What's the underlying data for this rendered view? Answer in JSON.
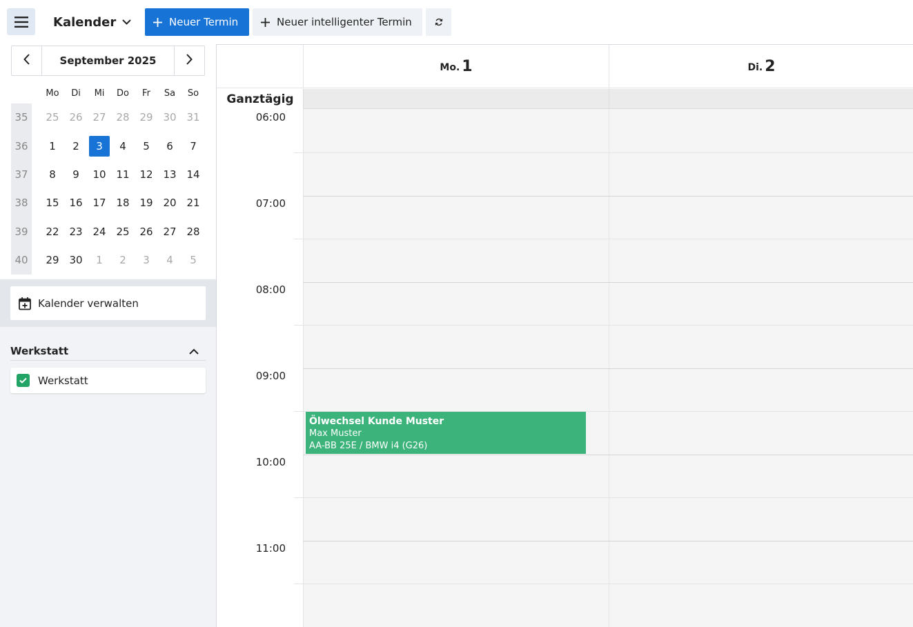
{
  "toolbar": {
    "calendar_title": "Kalender",
    "new_appointment": "Neuer Termin",
    "new_smart_appointment": "Neuer intelligenter Termin",
    "icons": {
      "menu": "hamburger-icon",
      "dropdown": "chevron-down-icon",
      "plus": "plus-icon",
      "refresh": "refresh-icon"
    },
    "colors": {
      "primary": "#1774d6",
      "secondary": "#eef1f5",
      "menu_bg": "#dfe8f3"
    }
  },
  "mini_calendar": {
    "month_label": "September 2025",
    "weekdays": [
      "Mo",
      "Di",
      "Mi",
      "Do",
      "Fr",
      "Sa",
      "So"
    ],
    "weeks": [
      {
        "week": "35",
        "days": [
          "25",
          "26",
          "27",
          "28",
          "29",
          "30",
          "31"
        ]
      },
      {
        "week": "36",
        "days": [
          "1",
          "2",
          "3",
          "4",
          "5",
          "6",
          "7"
        ]
      },
      {
        "week": "37",
        "days": [
          "8",
          "9",
          "10",
          "11",
          "12",
          "13",
          "14"
        ]
      },
      {
        "week": "38",
        "days": [
          "15",
          "16",
          "17",
          "18",
          "19",
          "20",
          "21"
        ]
      },
      {
        "week": "39",
        "days": [
          "22",
          "23",
          "24",
          "25",
          "26",
          "27",
          "28"
        ]
      },
      {
        "week": "40",
        "days": [
          "29",
          "30",
          "1",
          "2",
          "3",
          "4",
          "5"
        ]
      }
    ],
    "selected_day": "3",
    "today_color": "#1774d6"
  },
  "sidebar": {
    "manage_calendars": "Kalender verwalten",
    "group_title": "Werkstatt",
    "group_items": [
      {
        "label": "Werkstatt",
        "checked": true,
        "color": "#22a466"
      }
    ]
  },
  "main": {
    "days": [
      {
        "name": "Mo.",
        "date": "1"
      },
      {
        "name": "Di.",
        "date": "2"
      }
    ],
    "all_day_label": "Ganztägig",
    "hours": [
      "06:00",
      "07:00",
      "08:00",
      "09:00",
      "10:00",
      "11:00"
    ],
    "events": [
      {
        "title": "Ölwechsel Kunde Muster",
        "customer": "Max Muster",
        "vehicle": "AA-BB 25E / BMW i4 (G26)",
        "color": "#3cb37a"
      }
    ]
  }
}
